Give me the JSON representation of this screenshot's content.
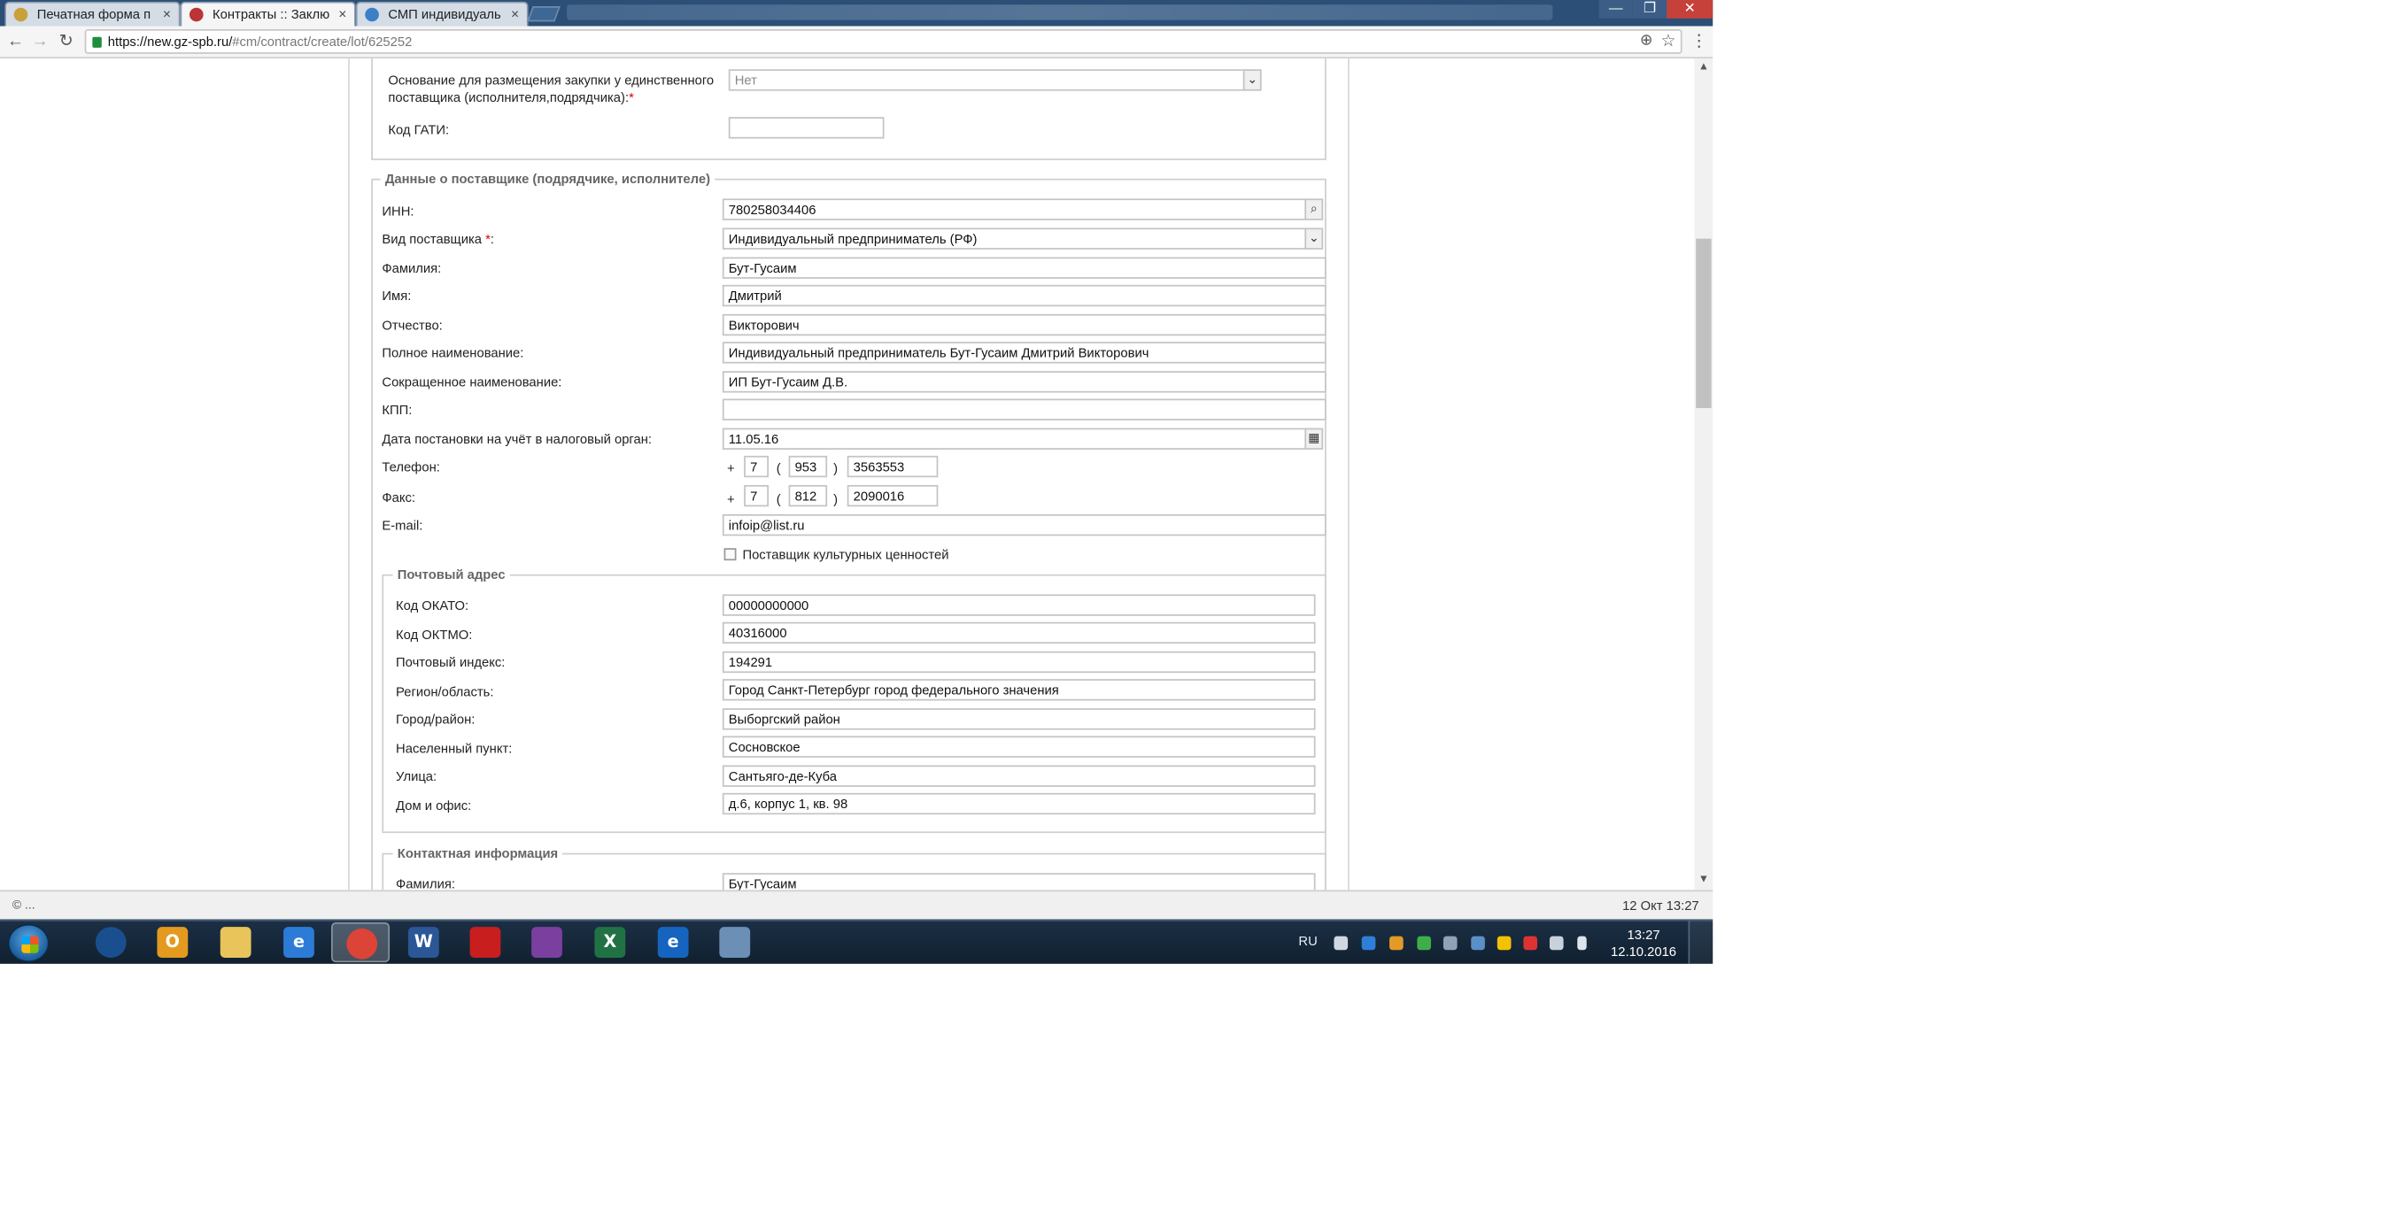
{
  "browser": {
    "tabs": [
      {
        "label": "Печатная форма п",
        "close": "×"
      },
      {
        "label": "Контракты :: Заклю",
        "close": "×"
      },
      {
        "label": "СМП индивидуаль",
        "close": "×"
      }
    ],
    "window_controls": {
      "minimize": "—",
      "maximize": "❐",
      "close": "✕"
    },
    "back": "←",
    "forward": "→",
    "reload": "↻",
    "url_host": "https://new.gz-spb.ru/",
    "url_path": "#cm/contract/create/lot/625252",
    "zoom_glyph": "⊕",
    "star_glyph": "☆",
    "menu_glyph": "⋮"
  },
  "form": {
    "top": {
      "basis_label": "Основание для размещения закупки у единственного поставщика (исполнителя,подрядчика):",
      "basis_required": "*",
      "basis_value": "Нет",
      "gati_label": "Код ГАТИ:",
      "gati_value": ""
    },
    "supplier": {
      "legend": "Данные о поставщике (подрядчике, исполнителе)",
      "inn_label": "ИНН:",
      "inn_value": "780258034406",
      "type_label": "Вид поставщика",
      "type_required": "*",
      "type_colon": ":",
      "type_value": "Индивидуальный предприниматель (РФ)",
      "surname_label": "Фамилия:",
      "surname_value": "Бут-Гусаим",
      "name_label": "Имя:",
      "name_value": "Дмитрий",
      "patronymic_label": "Отчество:",
      "patronymic_value": "Викторович",
      "fullname_label": "Полное наименование:",
      "fullname_value": "Индивидуальный предприниматель Бут-Гусаим Дмитрий Викторович",
      "shortname_label": "Сокращенное наименование:",
      "shortname_value": "ИП Бут-Гусаим Д.В.",
      "kpp_label": "КПП:",
      "kpp_value": "",
      "taxdate_label": "Дата постановки на учёт в налоговый орган:",
      "taxdate_value": "11.05.16",
      "phone_label": "Телефон:",
      "phone_plus": "+",
      "phone_country": "7",
      "phone_open": "(",
      "phone_code": "953",
      "phone_close": ")",
      "phone_number": "3563553",
      "fax_label": "Факс:",
      "fax_plus": "+",
      "fax_country": "7",
      "fax_open": "(",
      "fax_code": "812",
      "fax_close": ")",
      "fax_number": "2090016",
      "email_label": "E-mail:",
      "email_value": "infoip@list.ru",
      "cultural_label": "Поставщик культурных ценностей"
    },
    "postal": {
      "legend": "Почтовый адрес",
      "okato_label": "Код ОКАТО:",
      "okato_value": "00000000000",
      "oktmo_label": "Код ОКТМО:",
      "oktmo_value": "40316000",
      "index_label": "Почтовый индекс:",
      "index_value": "194291",
      "region_label": "Регион/область:",
      "region_value": "Город Санкт-Петербург город федерального значения",
      "city_label": "Город/район:",
      "city_value": "Выборгский район",
      "settlement_label": "Населенный пункт:",
      "settlement_value": "Сосновское",
      "street_label": "Улица:",
      "street_value": "Сантьяго-де-Куба",
      "house_label": "Дом и офис:",
      "house_value": "д.6, корпус 1, кв. 98"
    },
    "contact": {
      "legend": "Контактная информация",
      "surname_label": "Фамилия:",
      "surname_value": "Бут-Гусаим"
    }
  },
  "scroll": {
    "up": "▲",
    "down": "▼"
  },
  "status": {
    "left": "© ...",
    "right": "12 Окт 13:27"
  },
  "taskbar": {
    "apps": [
      {
        "name": "app-globe",
        "glyph": "",
        "color": "#1a4f8f"
      },
      {
        "name": "app-outlook",
        "glyph": "O",
        "color": "#e39a1f"
      },
      {
        "name": "app-explorer",
        "glyph": "",
        "color": "#e9c45a"
      },
      {
        "name": "app-ie",
        "glyph": "e",
        "color": "#2c7bd6"
      },
      {
        "name": "app-chrome",
        "glyph": "",
        "color": "#db4437"
      },
      {
        "name": "app-word",
        "glyph": "W",
        "color": "#2b5797"
      },
      {
        "name": "app-red",
        "glyph": "",
        "color": "#c81e1e"
      },
      {
        "name": "app-winrar",
        "glyph": "",
        "color": "#7b3fa0"
      },
      {
        "name": "app-excel",
        "glyph": "X",
        "color": "#207245"
      },
      {
        "name": "app-blue-e",
        "glyph": "e",
        "color": "#1565c0"
      },
      {
        "name": "app-paint",
        "glyph": "",
        "color": "#6b8fb5"
      }
    ],
    "lang": "RU",
    "time": "13:27",
    "date": "12.10.2016"
  }
}
